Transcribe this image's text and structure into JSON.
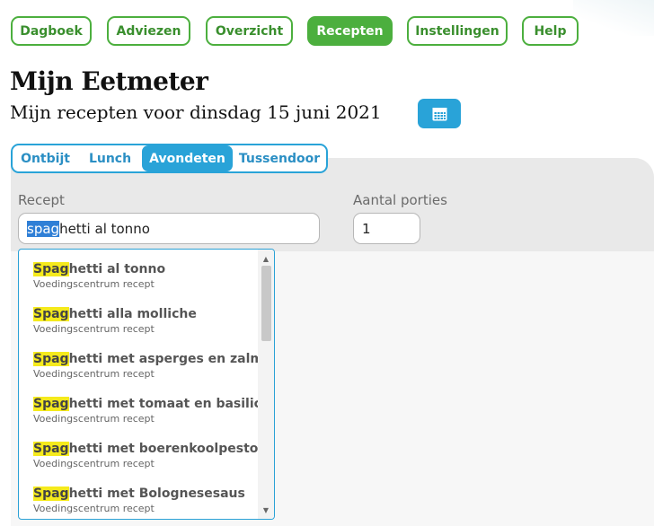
{
  "nav": {
    "items": [
      {
        "label": "Dagboek"
      },
      {
        "label": "Adviezen"
      },
      {
        "label": "Overzicht"
      },
      {
        "label": "Recepten",
        "active": true
      },
      {
        "label": "Instellingen"
      },
      {
        "label": "Help"
      }
    ]
  },
  "header": {
    "title": "Mijn Eetmeter",
    "subtitle": "Mijn recepten voor dinsdag 15 juni 2021",
    "calendar_icon": "calendar-icon"
  },
  "meal_tabs": [
    {
      "label": "Ontbijt"
    },
    {
      "label": "Lunch"
    },
    {
      "label": "Avondeten",
      "active": true
    },
    {
      "label": "Tussendoor"
    }
  ],
  "form": {
    "recipe_label": "Recept",
    "recipe_value_selected": "spag",
    "recipe_value_rest": "hetti al tonno",
    "portions_label": "Aantal porties",
    "portions_value": "1"
  },
  "suggestions": {
    "match": "Spag",
    "items": [
      {
        "rest": "hetti al tonno",
        "source": "Voedingscentrum recept"
      },
      {
        "rest": "hetti alla molliche",
        "source": "Voedingscentrum recept"
      },
      {
        "rest": "hetti met asperges en zalm",
        "source": "Voedingscentrum recept"
      },
      {
        "rest": "hetti met tomaat en basilicum",
        "source": "Voedingscentrum recept"
      },
      {
        "rest": "hetti met boerenkoolpesto",
        "source": "Voedingscentrum recept"
      },
      {
        "rest": "hetti met Bolognesesaus",
        "source": "Voedingscentrum recept"
      }
    ]
  },
  "colors": {
    "nav_green": "#4caf3e",
    "tab_blue": "#29a3d8",
    "highlight": "#f5ea1c"
  }
}
